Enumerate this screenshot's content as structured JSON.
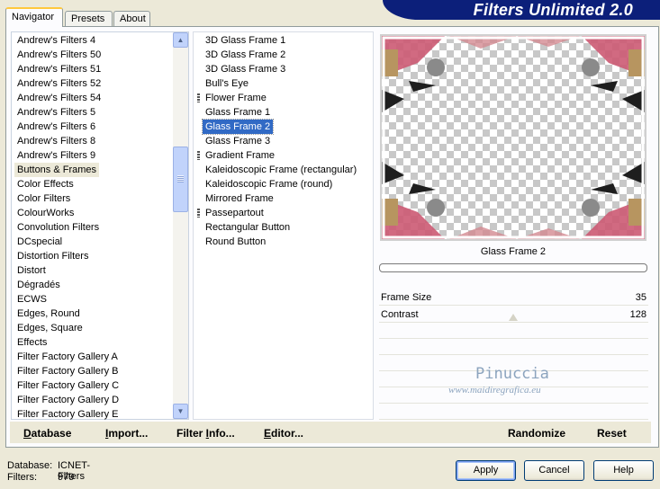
{
  "header": {
    "title": "Filters Unlimited 2.0"
  },
  "tabs": [
    {
      "label": "Navigator",
      "active": true
    },
    {
      "label": "Presets",
      "active": false
    },
    {
      "label": "About",
      "active": false
    }
  ],
  "categories": {
    "items": [
      "Andrew's Filters 4",
      "Andrew's Filters 50",
      "Andrew's Filters 51",
      "Andrew's Filters 52",
      "Andrew's Filters 54",
      "Andrew's Filters 5",
      "Andrew's Filters 6",
      "Andrew's Filters 8",
      "Andrew's Filters 9",
      "Buttons & Frames",
      "Color Effects",
      "Color Filters",
      "ColourWorks",
      "Convolution Filters",
      "DCspecial",
      "Distortion Filters",
      "Distort",
      "Dégradés",
      "ECWS",
      "Edges, Round",
      "Edges, Square",
      "Effects",
      "Filter Factory Gallery A",
      "Filter Factory Gallery B",
      "Filter Factory Gallery C",
      "Filter Factory Gallery D",
      "Filter Factory Gallery E"
    ],
    "selected_index": 9
  },
  "filters": {
    "items": [
      "3D Glass Frame 1",
      "3D Glass Frame 2",
      "3D Glass Frame 3",
      "Bull's Eye",
      "Flower Frame",
      "Glass Frame 1",
      "Glass Frame 2",
      "Glass Frame 3",
      "Gradient Frame",
      "Kaleidoscopic Frame (rectangular)",
      "Kaleidoscopic Frame (round)",
      "Mirrored Frame",
      "Passepartout",
      "Rectangular Button",
      "Round Button"
    ],
    "grip_items": [
      4,
      8,
      12
    ],
    "selected_index": 6
  },
  "preview": {
    "caption": "Glass Frame 2"
  },
  "params": [
    {
      "label": "Frame Size",
      "value": "35"
    },
    {
      "label": "Contrast",
      "value": "128"
    }
  ],
  "watermark": {
    "line1": "Pinuccia",
    "line2": "www.maidiregrafica.eu"
  },
  "toolbar": {
    "database": {
      "ul": "D",
      "rest": "atabase"
    },
    "import": {
      "ul": "I",
      "rest": "mport..."
    },
    "filter_info": {
      "pre": "Filter ",
      "ul": "I",
      "rest": "nfo..."
    },
    "editor": {
      "ul": "E",
      "rest": "ditor..."
    },
    "randomize": "Randomize",
    "reset": "Reset"
  },
  "status": {
    "database_label": "Database:",
    "database_value": "ICNET-Filters",
    "filters_label": "Filters:",
    "filters_value": "979"
  },
  "buttons": {
    "apply": "Apply",
    "cancel": "Cancel",
    "help": "Help"
  },
  "scroll": {
    "up_icon": "chevron-up-icon",
    "down_icon": "chevron-down-icon"
  }
}
